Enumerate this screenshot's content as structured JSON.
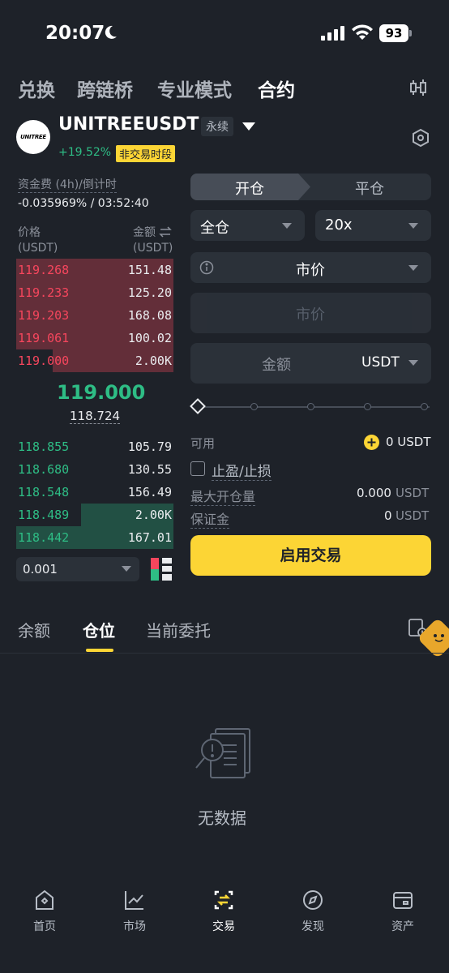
{
  "status_bar": {
    "time": "20:07",
    "battery": "93"
  },
  "top_tabs": [
    {
      "label": "兑换",
      "active": false
    },
    {
      "label": "跨链桥",
      "active": false
    },
    {
      "label": "专业模式",
      "active": false
    },
    {
      "label": "合约",
      "active": true
    }
  ],
  "symbol": {
    "logo_text": "UNITREE",
    "name": "UNITREEUSDT",
    "type_badge": "永续",
    "change": "+19.52%",
    "status_badge": "非交易时段"
  },
  "funding": {
    "label": "资金费 (4h)/倒计时",
    "value": "-0.035969% / 03:52:40"
  },
  "orderbook": {
    "price_header": "价格",
    "price_unit": "(USDT)",
    "amount_header": "金额",
    "amount_unit": "(USDT)",
    "asks": [
      {
        "price": "119.268",
        "amount": "151.48",
        "depth": 1.0
      },
      {
        "price": "119.233",
        "amount": "125.20",
        "depth": 1.0
      },
      {
        "price": "119.203",
        "amount": "168.08",
        "depth": 1.0
      },
      {
        "price": "119.061",
        "amount": "100.02",
        "depth": 1.0
      },
      {
        "price": "119.000",
        "amount": "2.00K",
        "depth": 0.77
      }
    ],
    "last_price": "119.000",
    "mark_price": "118.724",
    "bids": [
      {
        "price": "118.855",
        "amount": "105.79",
        "depth": 0
      },
      {
        "price": "118.680",
        "amount": "130.55",
        "depth": 0
      },
      {
        "price": "118.548",
        "amount": "156.49",
        "depth": 0
      },
      {
        "price": "118.489",
        "amount": "2.00K",
        "depth": 0.59
      },
      {
        "price": "118.442",
        "amount": "167.01",
        "depth": 1.0
      }
    ],
    "precision": "0.001"
  },
  "order_form": {
    "open_tab": "开仓",
    "close_tab": "平仓",
    "margin_mode": "全仓",
    "leverage": "20x",
    "order_type": "市价",
    "price_placeholder": "市价",
    "amount_placeholder": "金额",
    "amount_unit": "USDT",
    "available_label": "可用",
    "available_value": "0 USDT",
    "tpsl_label": "止盈/止损",
    "max_label": "最大开仓量",
    "max_value": "0.000",
    "max_unit": "USDT",
    "margin_label": "保证金",
    "margin_value": "0",
    "margin_unit": "USDT",
    "submit": "启用交易"
  },
  "bottom_tabs": [
    {
      "label": "余额",
      "active": false
    },
    {
      "label": "仓位",
      "active": true
    },
    {
      "label": "当前委托",
      "active": false
    }
  ],
  "empty_state": "无数据",
  "nav": [
    {
      "label": "首页",
      "icon": "home-icon",
      "active": false
    },
    {
      "label": "市场",
      "icon": "chart-icon",
      "active": false
    },
    {
      "label": "交易",
      "icon": "trade-icon",
      "active": true
    },
    {
      "label": "发现",
      "icon": "compass-icon",
      "active": false
    },
    {
      "label": "资产",
      "icon": "wallet-icon",
      "active": false
    }
  ],
  "colors": {
    "accent": "#fcd535",
    "green": "#2ebd85",
    "red": "#f6465d",
    "background": "#1e2229",
    "panel": "#2b3139"
  }
}
